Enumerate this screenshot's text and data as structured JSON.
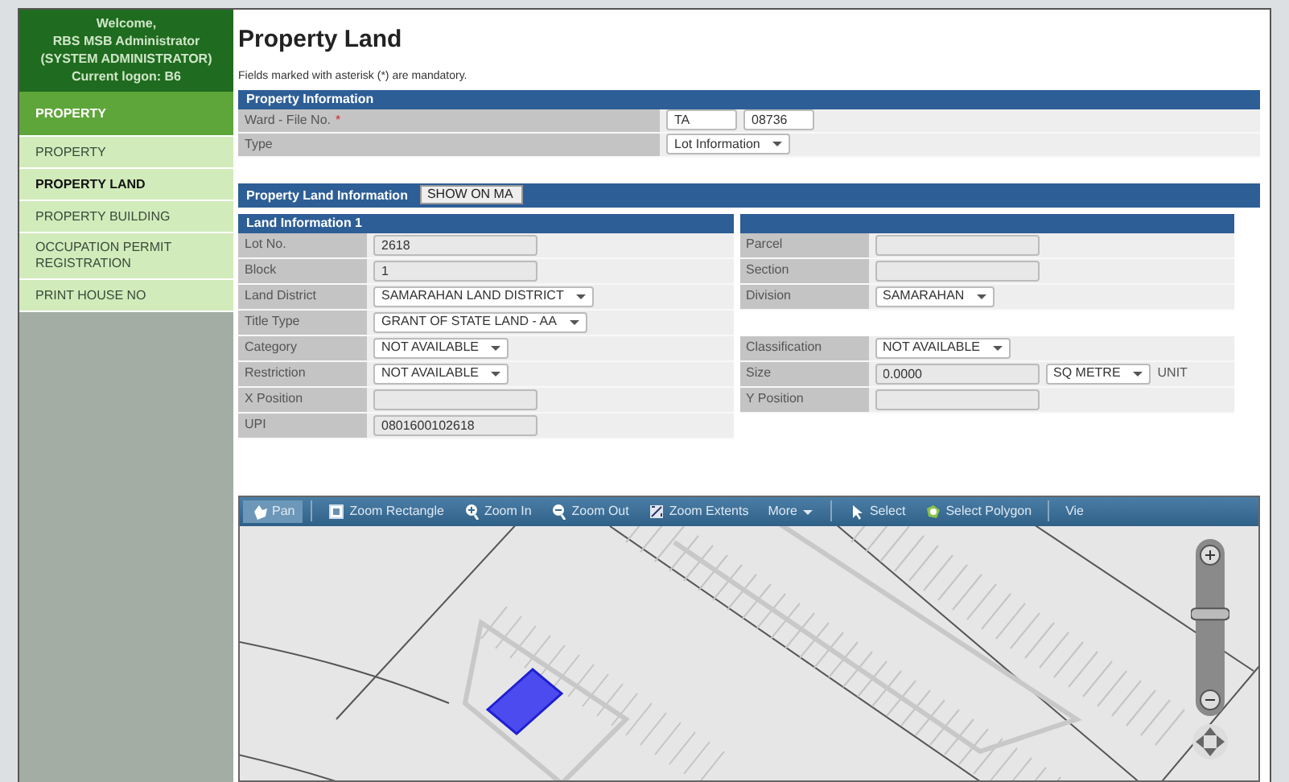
{
  "sidebar": {
    "welcome": [
      "Welcome,",
      "RBS MSB Administrator",
      "(SYSTEM ADMINISTRATOR)",
      "Current logon: B6"
    ],
    "items": [
      {
        "label": "PROPERTY",
        "kind": "header",
        "selected": false
      },
      {
        "label": "PROPERTY",
        "kind": "link",
        "selected": false
      },
      {
        "label": "PROPERTY LAND",
        "kind": "link",
        "selected": true
      },
      {
        "label": "PROPERTY BUILDING",
        "kind": "link",
        "selected": false
      },
      {
        "label": "OCCUPATION PERMIT REGISTRATION",
        "kind": "link",
        "selected": false
      },
      {
        "label": "PRINT HOUSE NO",
        "kind": "link",
        "selected": false
      }
    ]
  },
  "page": {
    "title": "Property Land",
    "note": "Fields marked with asterisk (*) are mandatory."
  },
  "property_information": {
    "title": "Property Information",
    "rows": [
      {
        "label": "Ward - File No.",
        "required_mark": "*",
        "controls": [
          {
            "kind": "text",
            "value": "TA",
            "readonly": false
          },
          {
            "kind": "text",
            "value": "08736",
            "readonly": false
          }
        ]
      },
      {
        "label": "Type",
        "controls": [
          {
            "kind": "select",
            "value": "Lot Information"
          }
        ]
      }
    ]
  },
  "land_section": {
    "title": "Property Land Information",
    "button": "SHOW ON MA",
    "subtitle": "Land Information 1",
    "left": [
      {
        "label": "Lot No.",
        "controls": [
          {
            "kind": "text",
            "value": "2618",
            "readonly": true
          }
        ]
      },
      {
        "label": "Block",
        "controls": [
          {
            "kind": "text",
            "value": "1",
            "readonly": true
          }
        ]
      },
      {
        "label": "Land District",
        "controls": [
          {
            "kind": "select",
            "value": "SAMARAHAN LAND DISTRICT"
          }
        ]
      },
      {
        "label": "Title Type",
        "controls": [
          {
            "kind": "select",
            "value": "GRANT OF STATE LAND - AA"
          }
        ]
      },
      {
        "label": "Category",
        "controls": [
          {
            "kind": "select",
            "value": "NOT AVAILABLE"
          }
        ]
      },
      {
        "label": "Restriction",
        "controls": [
          {
            "kind": "select",
            "value": "NOT AVAILABLE"
          }
        ]
      },
      {
        "label": "X Position",
        "controls": [
          {
            "kind": "text",
            "readonly": true
          }
        ]
      },
      {
        "label": "UPI",
        "controls": [
          {
            "kind": "text",
            "value": "0801600102618",
            "readonly": true
          }
        ]
      }
    ],
    "right": [
      {
        "label": "Parcel",
        "controls": [
          {
            "kind": "text",
            "readonly": true
          }
        ]
      },
      {
        "label": "Section",
        "controls": [
          {
            "kind": "text",
            "readonly": true
          }
        ]
      },
      {
        "label": "Division",
        "controls": [
          {
            "kind": "select",
            "value": "SAMARAHAN"
          }
        ]
      },
      {
        "label": "Classification",
        "gap_before": true,
        "controls": [
          {
            "kind": "select",
            "value": "NOT AVAILABLE"
          }
        ]
      },
      {
        "label": "Size",
        "controls": [
          {
            "kind": "text",
            "value": "0.0000",
            "readonly": true
          },
          {
            "kind": "select",
            "value": "SQ METRE"
          },
          {
            "kind": "unit",
            "value": "UNIT"
          }
        ]
      },
      {
        "label": "Y Position",
        "controls": [
          {
            "kind": "text",
            "readonly": true
          }
        ]
      }
    ]
  },
  "map": {
    "toolbar": [
      {
        "label": "Pan",
        "kind": "pan",
        "selected": true,
        "group_start": false
      },
      {
        "label": "Zoom Rectangle",
        "kind": "zoomrect",
        "selected": false,
        "group_start": true
      },
      {
        "label": "Zoom In",
        "kind": "zoomin",
        "selected": false,
        "group_start": false
      },
      {
        "label": "Zoom Out",
        "kind": "zoomout",
        "selected": false,
        "group_start": false
      },
      {
        "label": "Zoom Extents",
        "kind": "extents",
        "selected": false,
        "group_start": false
      },
      {
        "label": "More",
        "kind": "menu",
        "selected": false,
        "group_start": false
      },
      {
        "label": "Select",
        "kind": "select",
        "selected": false,
        "group_start": true
      },
      {
        "label": "Select Polygon",
        "kind": "polygon",
        "selected": false,
        "group_start": false
      },
      {
        "label": "Vie",
        "kind": "plain",
        "selected": false,
        "group_start": true
      }
    ],
    "zoom": {
      "level": 0.62
    }
  }
}
